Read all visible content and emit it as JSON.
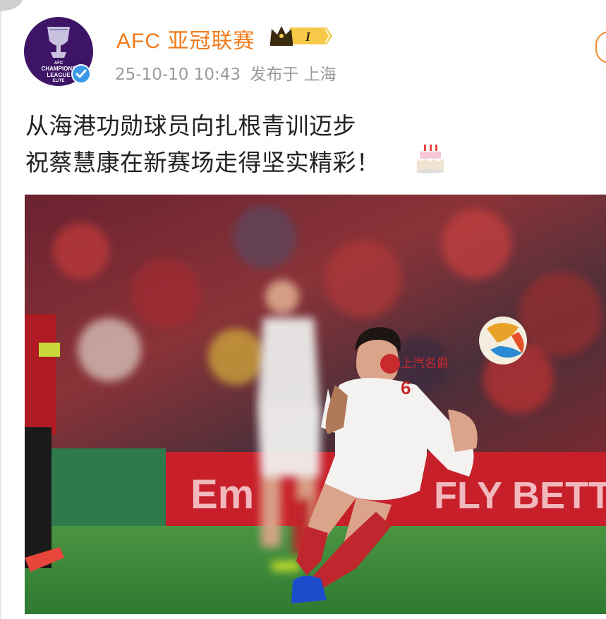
{
  "account": {
    "name": "AFC 亚冠联赛",
    "avatar_lines": [
      "AFC",
      "CHAMPIONS",
      "LEAGUE",
      "ELITE"
    ],
    "verified_icon": "verified-check-icon",
    "rank_badge": "I",
    "rank_icon": "crown-icon"
  },
  "meta": {
    "timestamp": "25-10-10 10:43",
    "location": "发布于 上海"
  },
  "post": {
    "line1": "从海港功勋球员向扎根青训迈步",
    "line2": "祝蔡慧康在新赛场走得坚实精彩！",
    "emoji": "birthday-cake-icon"
  },
  "photo": {
    "jersey_sponsor": "上汽名爵",
    "jersey_number": "6",
    "board_text_left": "Em",
    "board_text_right": "FLY BETTER",
    "colors": {
      "crowd": "#7a2a30",
      "board": "#c8202a",
      "pitch": "#3f8a3a",
      "kit": "#f4f2f0"
    }
  },
  "colors": {
    "accent": "#f27a1a",
    "verified": "#3a98e8",
    "meta": "#9a9a9a"
  }
}
